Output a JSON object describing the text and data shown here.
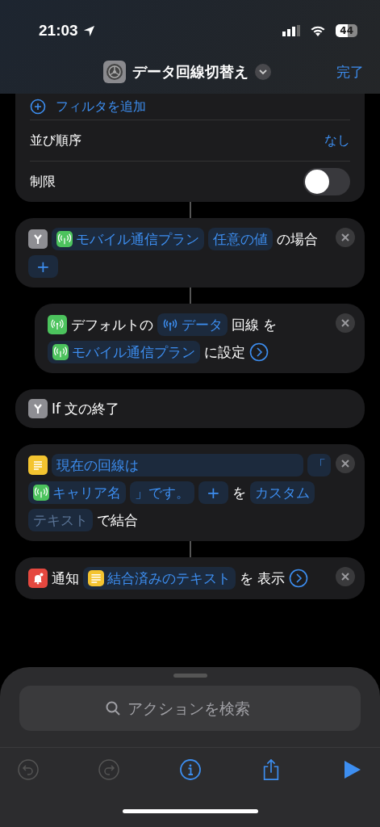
{
  "status_bar": {
    "time": "21:03",
    "battery": "44"
  },
  "header": {
    "title": "データ回線切替え",
    "done": "完了"
  },
  "filter_block": {
    "add_filter": "フィルタを追加",
    "rows": [
      {
        "kind": "value",
        "label": "並び順序",
        "value": "なし"
      },
      {
        "kind": "toggle",
        "label": "制限",
        "on": false
      }
    ]
  },
  "actions": [
    {
      "kind": "if",
      "removable": true,
      "tokens": [
        {
          "kind": "var-cellular",
          "text": "モバイル通信プラン"
        },
        {
          "kind": "var",
          "text": "任意の値"
        },
        {
          "kind": "text",
          "text": "の場合"
        },
        {
          "kind": "plus",
          "text": "+"
        }
      ],
      "children": [
        {
          "kind": "cellular",
          "removable": true,
          "tokens": [
            {
              "kind": "text",
              "text": "デフォルトの"
            },
            {
              "kind": "var-antenna",
              "text": "データ"
            },
            {
              "kind": "text",
              "text": "回線"
            },
            {
              "kind": "text",
              "text": "を"
            },
            {
              "kind": "var-cellular",
              "text": "モバイル通信プラン"
            },
            {
              "kind": "text",
              "text": "に設定"
            },
            {
              "kind": "chevron"
            }
          ]
        }
      ]
    },
    {
      "kind": "if",
      "removable": false,
      "tokens": [
        {
          "kind": "text",
          "text": "If 文の終了"
        }
      ]
    },
    {
      "kind": "text",
      "removable": true,
      "tokens": [
        {
          "kind": "field",
          "text": "現在の回線は"
        },
        {
          "kind": "var",
          "text": "「"
        },
        {
          "kind": "var-cellular",
          "text": "キャリア名"
        },
        {
          "kind": "var",
          "text": "」です。"
        },
        {
          "kind": "plus",
          "text": "+"
        },
        {
          "kind": "text",
          "text": "を"
        },
        {
          "kind": "var",
          "text": "カスタム"
        },
        {
          "kind": "placeholder",
          "text": "テキスト"
        },
        {
          "kind": "text",
          "text": "で結合"
        }
      ]
    },
    {
      "kind": "notify",
      "removable": true,
      "tokens": [
        {
          "kind": "text",
          "text": "通知"
        },
        {
          "kind": "var-text",
          "text": "結合済みのテキスト"
        },
        {
          "kind": "text",
          "text": "を"
        },
        {
          "kind": "text",
          "text": "表示"
        },
        {
          "kind": "chevron"
        }
      ]
    }
  ],
  "search": {
    "placeholder": "アクションを検索"
  },
  "toolbar": [
    {
      "kind": "undo",
      "disabled": true
    },
    {
      "kind": "redo",
      "disabled": true
    },
    {
      "kind": "info",
      "disabled": false
    },
    {
      "kind": "share",
      "disabled": false
    },
    {
      "kind": "run",
      "disabled": false
    }
  ]
}
